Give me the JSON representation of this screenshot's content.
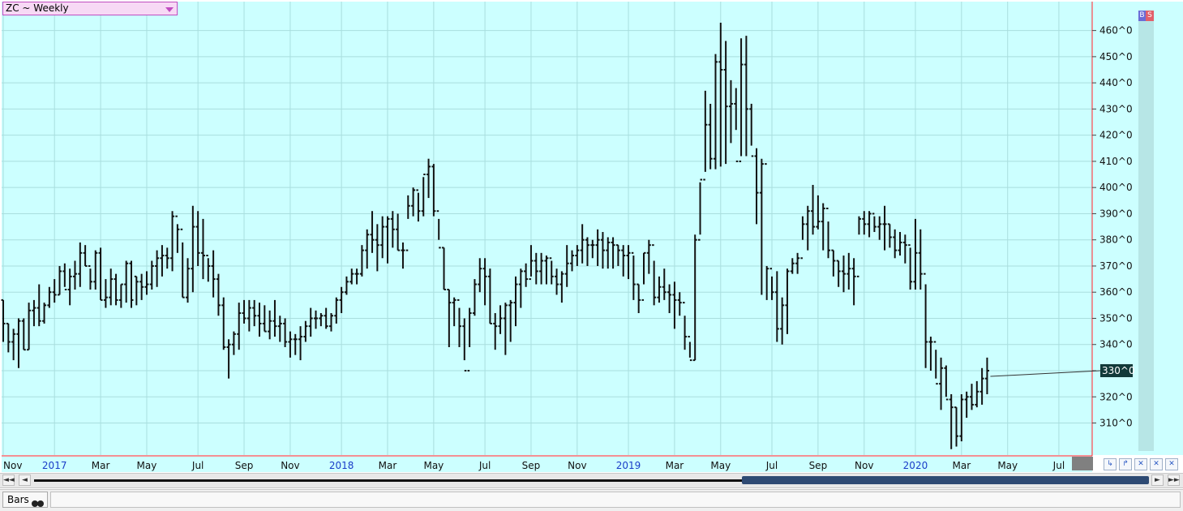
{
  "header": {
    "symbol_label": "ZC ~ Weekly"
  },
  "signals": {
    "buy": "B",
    "sell": "S"
  },
  "status": {
    "mode_label": "Bars"
  },
  "nav": {
    "first": "◄◄",
    "prev": "◄",
    "next": "►",
    "last": "►►"
  },
  "tools": [
    "↳",
    "↱",
    "✕",
    "✕",
    "✕"
  ],
  "colors": {
    "plot_bg": "#ccffff",
    "grid": "#a9dede",
    "bar": "#111111",
    "axis_red": "#e8202a",
    "year_label": "#1a3cc8",
    "last_price_bg": "#123a3a"
  },
  "chart_data": {
    "type": "ohlc",
    "title": "ZC ~ Weekly",
    "ylim": [
      300,
      470
    ],
    "y_ticks": [
      "310^0",
      "320^0",
      "330^0",
      "340^0",
      "350^0",
      "360^0",
      "370^0",
      "380^0",
      "390^0",
      "400^0",
      "410^0",
      "420^0",
      "430^0",
      "440^0",
      "450^0",
      "460^0"
    ],
    "y_tick_values": [
      310,
      320,
      330,
      340,
      350,
      360,
      370,
      380,
      390,
      400,
      410,
      420,
      430,
      440,
      450,
      460
    ],
    "last_price_label": "330^0",
    "last_price": 330,
    "x_labels": [
      {
        "label": "Nov",
        "year": false,
        "index": 0
      },
      {
        "label": "2017",
        "year": true,
        "index": 10
      },
      {
        "label": "Mar",
        "year": false,
        "index": 19
      },
      {
        "label": "May",
        "year": false,
        "index": 28
      },
      {
        "label": "Jul",
        "year": false,
        "index": 38
      },
      {
        "label": "Sep",
        "year": false,
        "index": 47
      },
      {
        "label": "Nov",
        "year": false,
        "index": 56
      },
      {
        "label": "2018",
        "year": true,
        "index": 66
      },
      {
        "label": "Mar",
        "year": false,
        "index": 75
      },
      {
        "label": "May",
        "year": false,
        "index": 84
      },
      {
        "label": "Jul",
        "year": false,
        "index": 94
      },
      {
        "label": "Sep",
        "year": false,
        "index": 103
      },
      {
        "label": "Nov",
        "year": false,
        "index": 112
      },
      {
        "label": "2019",
        "year": true,
        "index": 122
      },
      {
        "label": "Mar",
        "year": false,
        "index": 131
      },
      {
        "label": "May",
        "year": false,
        "index": 140
      },
      {
        "label": "Jul",
        "year": false,
        "index": 150
      },
      {
        "label": "Sep",
        "year": false,
        "index": 159
      },
      {
        "label": "Nov",
        "year": false,
        "index": 168
      },
      {
        "label": "2020",
        "year": true,
        "index": 178
      },
      {
        "label": "Mar",
        "year": false,
        "index": 187
      },
      {
        "label": "May",
        "year": false,
        "index": 196
      },
      {
        "label": "Jul",
        "year": false,
        "index": 206
      }
    ],
    "bars": [
      [
        357,
        341,
        357,
        348
      ],
      [
        348,
        337,
        348,
        341
      ],
      [
        346,
        334,
        341,
        344
      ],
      [
        350,
        331,
        344,
        349
      ],
      [
        350,
        338,
        349,
        338
      ],
      [
        356,
        338,
        338,
        353
      ],
      [
        357,
        347,
        353,
        354
      ],
      [
        363,
        347,
        354,
        349
      ],
      [
        356,
        348,
        349,
        355
      ],
      [
        362,
        354,
        355,
        360
      ],
      [
        365,
        356,
        360,
        359
      ],
      [
        370,
        359,
        359,
        368
      ],
      [
        371,
        362,
        368,
        361
      ],
      [
        369,
        355,
        361,
        366
      ],
      [
        372,
        361,
        366,
        367
      ],
      [
        379,
        362,
        367,
        375
      ],
      [
        378,
        370,
        375,
        370
      ],
      [
        369,
        361,
        370,
        364
      ],
      [
        376,
        361,
        364,
        375
      ],
      [
        377,
        357,
        375,
        357
      ],
      [
        365,
        354,
        357,
        358
      ],
      [
        369,
        355,
        358,
        365
      ],
      [
        367,
        355,
        365,
        357
      ],
      [
        363,
        354,
        357,
        363
      ],
      [
        372,
        356,
        363,
        371
      ],
      [
        372,
        354,
        371,
        357
      ],
      [
        366,
        355,
        366,
        364
      ],
      [
        367,
        357,
        364,
        362
      ],
      [
        368,
        359,
        362,
        363
      ],
      [
        372,
        361,
        363,
        370
      ],
      [
        376,
        362,
        370,
        373
      ],
      [
        378,
        366,
        373,
        374
      ],
      [
        377,
        369,
        374,
        373
      ],
      [
        391,
        368,
        373,
        389
      ],
      [
        386,
        375,
        389,
        384
      ],
      [
        379,
        358,
        384,
        358
      ],
      [
        373,
        356,
        358,
        369
      ],
      [
        393,
        360,
        369,
        385
      ],
      [
        391,
        370,
        385,
        375
      ],
      [
        388,
        365,
        375,
        374
      ],
      [
        373,
        364,
        374,
        370
      ],
      [
        376,
        358,
        370,
        365
      ],
      [
        367,
        351,
        365,
        355
      ],
      [
        358,
        338,
        355,
        339
      ],
      [
        342,
        327,
        339,
        340
      ],
      [
        345,
        336,
        340,
        344
      ],
      [
        356,
        338,
        344,
        352
      ],
      [
        357,
        348,
        352,
        350
      ],
      [
        357,
        345,
        350,
        354
      ],
      [
        357,
        347,
        354,
        351
      ],
      [
        356,
        343,
        351,
        348
      ],
      [
        355,
        345,
        348,
        345
      ],
      [
        353,
        342,
        345,
        349
      ],
      [
        357,
        343,
        349,
        347
      ],
      [
        351,
        341,
        347,
        348
      ],
      [
        350,
        339,
        348,
        341
      ],
      [
        345,
        335,
        341,
        342
      ],
      [
        344,
        336,
        342,
        342
      ],
      [
        347,
        334,
        342,
        343
      ],
      [
        349,
        341,
        343,
        347
      ],
      [
        354,
        343,
        347,
        350
      ],
      [
        353,
        346,
        350,
        350
      ],
      [
        352,
        347,
        350,
        351
      ],
      [
        354,
        346,
        351,
        347
      ],
      [
        352,
        345,
        347,
        351
      ],
      [
        358,
        348,
        351,
        357
      ],
      [
        362,
        352,
        357,
        360
      ],
      [
        366,
        359,
        360,
        364
      ],
      [
        369,
        363,
        364,
        367
      ],
      [
        369,
        363,
        367,
        367
      ],
      [
        378,
        366,
        367,
        376
      ],
      [
        384,
        369,
        376,
        382
      ],
      [
        391,
        375,
        382,
        380
      ],
      [
        386,
        368,
        380,
        378
      ],
      [
        389,
        373,
        378,
        385
      ],
      [
        389,
        371,
        385,
        388
      ],
      [
        391,
        377,
        388,
        384
      ],
      [
        390,
        376,
        384,
        376
      ],
      [
        379,
        369,
        376,
        376
      ],
      [
        397,
        388,
        376,
        393
      ],
      [
        400,
        389,
        393,
        399
      ],
      [
        398,
        387,
        399,
        391
      ],
      [
        404,
        389,
        391,
        405
      ],
      [
        411,
        396,
        405,
        408
      ],
      [
        409,
        389,
        408,
        391
      ],
      [
        388,
        380,
        391,
        377
      ],
      [
        377,
        361,
        377,
        361
      ],
      [
        361,
        339,
        361,
        356
      ],
      [
        358,
        347,
        356,
        357
      ],
      [
        354,
        339,
        357,
        347
      ],
      [
        350,
        334,
        347,
        330
      ],
      [
        354,
        339,
        330,
        352
      ],
      [
        365,
        351,
        352,
        363
      ],
      [
        373,
        360,
        363,
        369
      ],
      [
        373,
        355,
        369,
        366
      ],
      [
        369,
        348,
        366,
        348
      ],
      [
        352,
        338,
        348,
        347
      ],
      [
        355,
        344,
        347,
        350
      ],
      [
        356,
        336,
        350,
        355
      ],
      [
        357,
        341,
        355,
        356
      ],
      [
        366,
        347,
        356,
        363
      ],
      [
        369,
        354,
        363,
        368
      ],
      [
        371,
        362,
        368,
        365
      ],
      [
        378,
        366,
        365,
        372
      ],
      [
        375,
        363,
        372,
        368
      ],
      [
        375,
        363,
        368,
        372
      ],
      [
        374,
        363,
        372,
        373
      ],
      [
        372,
        363,
        373,
        366
      ],
      [
        369,
        359,
        366,
        363
      ],
      [
        368,
        356,
        363,
        367
      ],
      [
        378,
        362,
        367,
        371
      ],
      [
        376,
        368,
        371,
        374
      ],
      [
        378,
        370,
        374,
        376
      ],
      [
        386,
        371,
        376,
        380
      ],
      [
        381,
        370,
        380,
        378
      ],
      [
        380,
        373,
        378,
        378
      ],
      [
        384,
        370,
        378,
        380
      ],
      [
        383,
        369,
        380,
        376
      ],
      [
        381,
        369,
        376,
        379
      ],
      [
        381,
        369,
        379,
        378
      ],
      [
        378,
        370,
        378,
        376
      ],
      [
        378,
        366,
        376,
        374
      ],
      [
        378,
        365,
        374,
        375
      ],
      [
        374,
        357,
        375,
        363
      ],
      [
        363,
        352,
        363,
        357
      ],
      [
        375,
        363,
        357,
        375
      ],
      [
        380,
        367,
        375,
        378
      ],
      [
        372,
        355,
        378,
        358
      ],
      [
        366,
        356,
        358,
        362
      ],
      [
        369,
        357,
        362,
        360
      ],
      [
        363,
        352,
        360,
        359
      ],
      [
        364,
        346,
        359,
        357
      ],
      [
        360,
        351,
        357,
        356
      ],
      [
        351,
        338,
        356,
        343
      ],
      [
        341,
        335,
        343,
        334
      ],
      [
        382,
        334,
        334,
        380
      ],
      [
        402,
        382,
        380,
        403
      ],
      [
        437,
        406,
        403,
        424
      ],
      [
        432,
        407,
        424,
        411
      ],
      [
        451,
        407,
        411,
        448
      ],
      [
        463,
        408,
        448,
        445
      ],
      [
        456,
        409,
        445,
        431
      ],
      [
        441,
        417,
        431,
        432
      ],
      [
        438,
        422,
        432,
        410
      ],
      [
        457,
        412,
        410,
        447
      ],
      [
        458,
        412,
        447,
        430
      ],
      [
        432,
        416,
        430,
        412
      ],
      [
        415,
        386,
        412,
        398
      ],
      [
        411,
        359,
        398,
        409
      ],
      [
        370,
        357,
        409,
        369
      ],
      [
        366,
        357,
        369,
        360
      ],
      [
        368,
        341,
        360,
        346
      ],
      [
        358,
        340,
        346,
        355
      ],
      [
        369,
        344,
        355,
        368
      ],
      [
        373,
        367,
        368,
        371
      ],
      [
        375,
        367,
        371,
        373
      ],
      [
        389,
        380,
        373,
        386
      ],
      [
        393,
        376,
        386,
        391
      ],
      [
        401,
        382,
        391,
        385
      ],
      [
        397,
        384,
        385,
        387
      ],
      [
        394,
        376,
        387,
        392
      ],
      [
        387,
        373,
        392,
        376
      ],
      [
        376,
        366,
        376,
        372
      ],
      [
        372,
        362,
        372,
        368
      ],
      [
        374,
        360,
        368,
        367
      ],
      [
        375,
        361,
        367,
        369
      ],
      [
        373,
        355,
        369,
        366
      ],
      [
        389,
        382,
        366,
        388
      ],
      [
        391,
        382,
        388,
        386
      ],
      [
        391,
        381,
        386,
        390
      ],
      [
        389,
        383,
        390,
        385
      ],
      [
        389,
        380,
        385,
        386
      ],
      [
        393,
        376,
        386,
        386
      ],
      [
        386,
        377,
        386,
        381
      ],
      [
        384,
        373,
        381,
        376
      ],
      [
        383,
        374,
        376,
        379
      ],
      [
        382,
        371,
        379,
        378
      ],
      [
        377,
        361,
        378,
        364
      ],
      [
        388,
        361,
        364,
        375
      ],
      [
        384,
        361,
        375,
        367
      ],
      [
        363,
        331,
        367,
        341
      ],
      [
        343,
        330,
        341,
        341
      ],
      [
        338,
        327,
        341,
        325
      ],
      [
        335,
        315,
        325,
        331
      ],
      [
        332,
        320,
        331,
        319
      ],
      [
        321,
        300,
        319,
        316
      ],
      [
        316,
        301,
        316,
        305
      ],
      [
        321,
        303,
        305,
        319
      ],
      [
        322,
        312,
        319,
        320
      ],
      [
        325,
        315,
        320,
        317
      ],
      [
        326,
        316,
        317,
        322
      ],
      [
        331,
        317,
        322,
        327
      ],
      [
        335,
        321,
        327,
        330
      ]
    ]
  }
}
